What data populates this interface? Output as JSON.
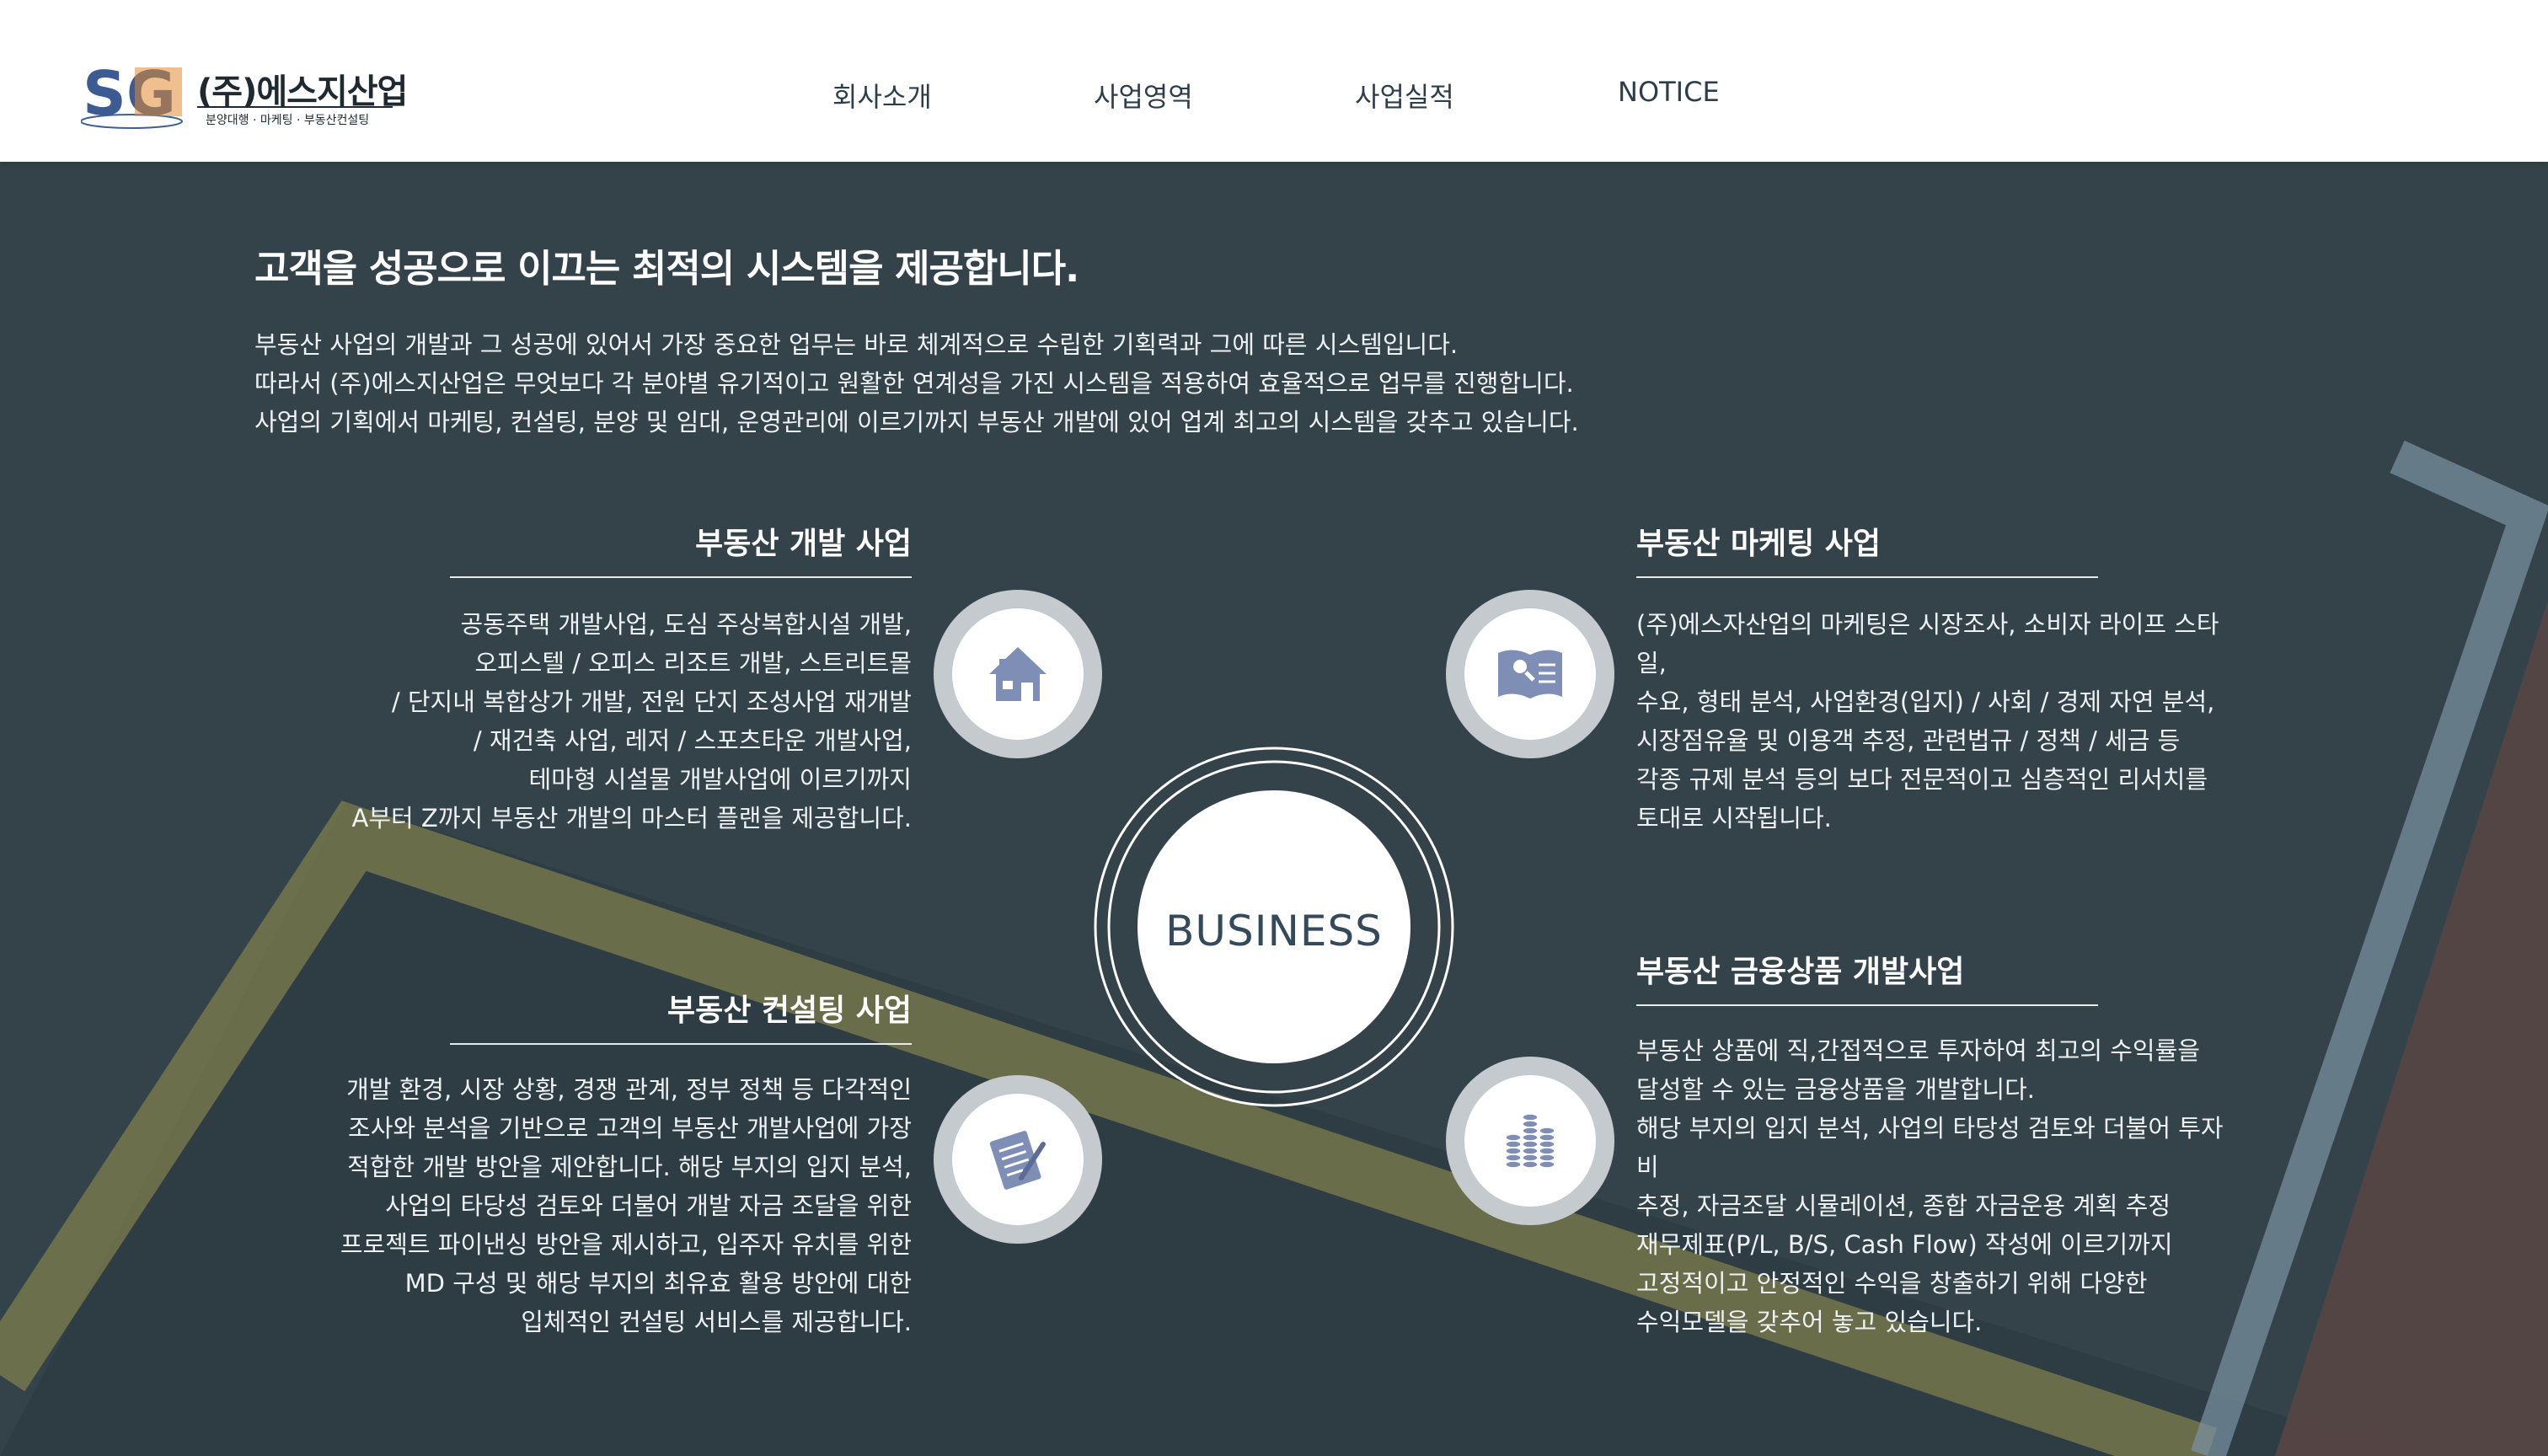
{
  "brand": {
    "logo_letters": "SG",
    "company_name": "(주)에스지산업",
    "tagline": "분양대행 · 마케팅 · 부동산컨설팅"
  },
  "nav": {
    "items": [
      "회사소개",
      "사업영역",
      "사업실적",
      "NOTICE"
    ]
  },
  "intro": {
    "headline": "고객을 성공으로 이끄는 최적의 시스템을 제공합니다.",
    "lines": [
      "부동산 사업의 개발과 그 성공에 있어서 가장 중요한 업무는 바로 체계적으로 수립한 기획력과 그에 따른 시스템입니다.",
      "따라서 (주)에스지산업은 무엇보다 각 분야별 유기적이고 원활한 연계성을 가진 시스템을 적용하여 효율적으로 업무를 진행합니다.",
      "사업의 기획에서 마케팅, 컨설팅, 분양 및 임대, 운영관리에 이르기까지 부동산 개발에 있어 업계 최고의 시스템을 갖추고 있습니다."
    ]
  },
  "center": {
    "label": "BUSINESS"
  },
  "sections": {
    "development": {
      "title": "부동산 개발 사업",
      "icon": "house-icon",
      "lines": [
        "공동주택 개발사업, 도심 주상복합시설 개발,",
        "오피스텔 / 오피스 리조트 개발, 스트리트몰",
        "/ 단지내 복합상가 개발, 전원 단지 조성사업 재개발",
        "/ 재건축 사업, 레저 / 스포츠타운 개발사업,",
        "테마형 시설물 개발사업에 이르기까지",
        "A부터 Z까지 부동산 개발의 마스터 플랜을 제공합니다."
      ]
    },
    "marketing": {
      "title": "부동산 마케팅 사업",
      "icon": "book-search-icon",
      "lines": [
        "(주)에스자산업의 마케팅은 시장조사, 소비자 라이프 스타",
        "일,",
        "수요, 형태 분석, 사업환경(입지) / 사회 / 경제 자연 분석,",
        "시장점유율 및 이용객 추정, 관련법규 / 정책 / 세금 등",
        "각종 규제 분석 등의 보다 전문적이고 심층적인 리서치를",
        "토대로 시작됩니다."
      ]
    },
    "consulting": {
      "title": "부동산 컨설팅 사업",
      "icon": "document-pen-icon",
      "lines": [
        "개발 환경, 시장 상황, 경쟁 관계, 정부 정책 등 다각적인",
        "조사와 분석을 기반으로 고객의 부동산 개발사업에 가장",
        "적합한 개발 방안을 제안합니다. 해당 부지의 입지 분석,",
        "사업의 타당성 검토와 더불어 개발 자금 조달을 위한",
        "프로젝트 파이낸싱 방안을 제시하고, 입주자 유치를 위한",
        "MD 구성 및 해당 부지의 최유효 활용 방안에 대한",
        "입체적인 컨설팅 서비스를 제공합니다."
      ]
    },
    "finance": {
      "title": "부동산 금융상품 개발사업",
      "icon": "coin-stacks-icon",
      "lines": [
        "부동산 상품에 직,간접적으로 투자하여 최고의 수익률을",
        "달성할 수 있는 금융상품을 개발합니다.",
        "해당 부지의 입지 분석, 사업의 타당성 검토와 더불어 투자",
        "비",
        "추정, 자금조달 시뮬레이션, 종합 자금운용 계획 추정",
        "재무제표(P/L, B/S, Cash Flow) 작성에 이르기까지",
        "고정적이고 안정적인 수익을 창출하기 위해 다양한",
        "수익모델을 갖추어 놓고 있습니다."
      ]
    }
  },
  "colors": {
    "background": "#2f3e45",
    "header": "#ffffff",
    "accent_yellow": "#8e8a55",
    "accent_blue": "#7d95a6",
    "icon_blue": "#7f8eb4"
  }
}
